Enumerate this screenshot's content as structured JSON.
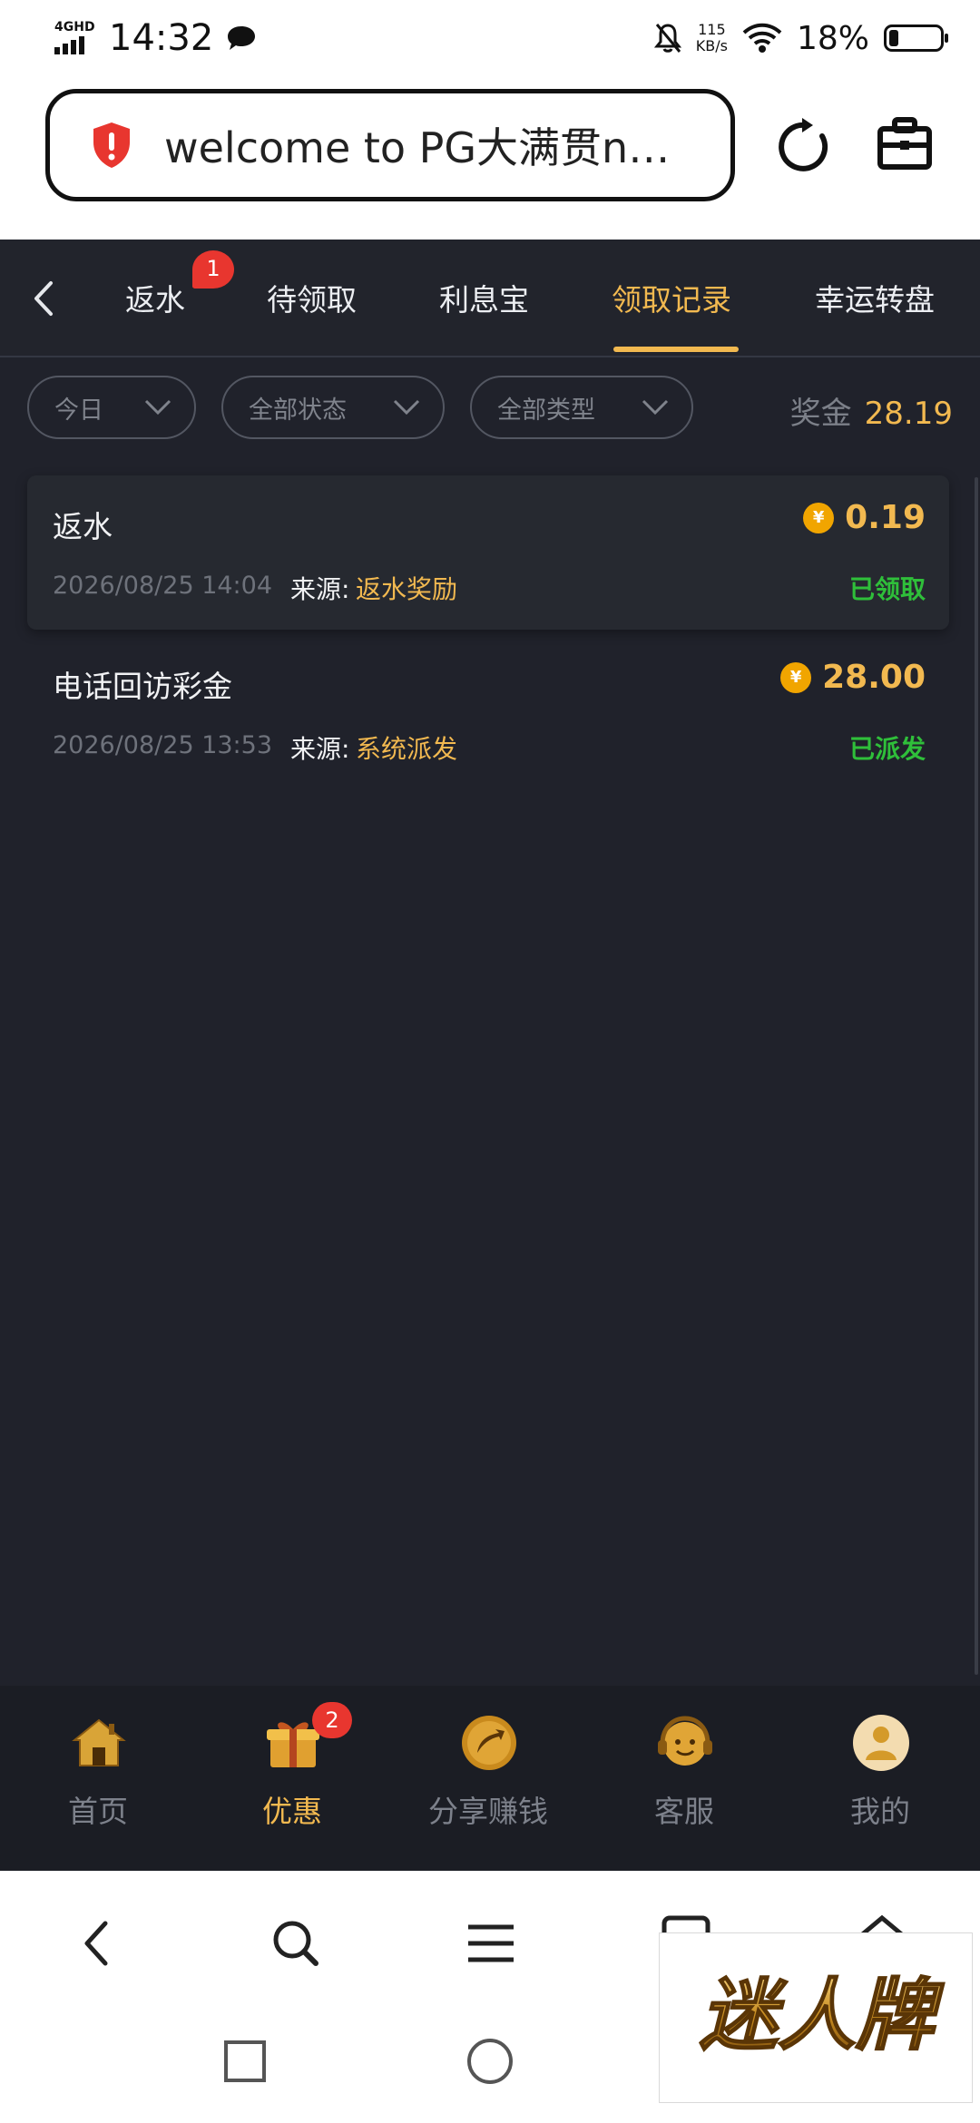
{
  "status_bar": {
    "network": "4GHD",
    "time": "14:32",
    "speed_value": "115",
    "speed_unit": "KB/s",
    "battery_pct": "18%"
  },
  "browser": {
    "url_text": "welcome to PG大满贯n…"
  },
  "tabs": [
    {
      "label": "返水",
      "badge": "1",
      "active": false
    },
    {
      "label": "待领取",
      "active": false
    },
    {
      "label": "利息宝",
      "active": false
    },
    {
      "label": "领取记录",
      "active": true
    },
    {
      "label": "幸运转盘",
      "active": false
    }
  ],
  "filters": {
    "date": "今日",
    "status": "全部状态",
    "type": "全部类型"
  },
  "bonus": {
    "label": "奖金",
    "value": "28.19"
  },
  "records": [
    {
      "title": "返水",
      "amount": "0.19",
      "currency_symbol": "¥",
      "date": "2026/08/25 14:04",
      "source_label": "来源:",
      "source": "返水奖励",
      "status": "已领取"
    },
    {
      "title": "电话回访彩金",
      "amount": "28.00",
      "currency_symbol": "¥",
      "date": "2026/08/25 13:53",
      "source_label": "来源:",
      "source": "系统派发",
      "status": "已派发"
    }
  ],
  "bottom_nav": [
    {
      "label": "首页",
      "icon": "home-icon",
      "active": false
    },
    {
      "label": "优惠",
      "icon": "gift-icon",
      "active": true,
      "badge": "2"
    },
    {
      "label": "分享赚钱",
      "icon": "share-icon",
      "active": false
    },
    {
      "label": "客服",
      "icon": "support-icon",
      "active": false
    },
    {
      "label": "我的",
      "icon": "profile-icon",
      "active": false
    }
  ],
  "watermark": {
    "text": "迷人牌"
  },
  "colors": {
    "accent": "#f2b950",
    "status_green": "#2fbf3a",
    "badge_red": "#e8362f",
    "app_bg": "#20222b"
  }
}
